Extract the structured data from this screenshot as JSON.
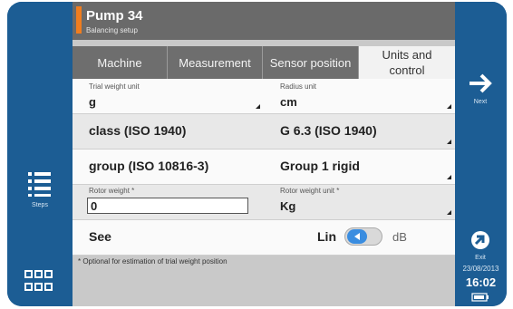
{
  "header": {
    "title": "Pump 34",
    "subtitle": "Balancing setup"
  },
  "tabs": [
    {
      "label": "Machine"
    },
    {
      "label": "Measurement"
    },
    {
      "label": "Sensor position"
    },
    {
      "label_line1": "Units and",
      "label_line2": "control"
    }
  ],
  "rows": {
    "trial_weight_unit": {
      "label": "Trial weight unit",
      "value": "g"
    },
    "radius_unit": {
      "label": "Radius unit",
      "value": "cm"
    },
    "class": {
      "value": "class (ISO 1940)"
    },
    "g_class": {
      "value": "G 6.3 (ISO 1940)"
    },
    "group": {
      "value": "group (ISO 10816-3)"
    },
    "group_value": {
      "value": "Group 1 rigid"
    },
    "rotor_weight": {
      "label": "Rotor weight *",
      "value": "0"
    },
    "rotor_weight_unit": {
      "label": "Rotor weight unit *",
      "value": "Kg"
    },
    "see": {
      "label": "See",
      "left": "Lin",
      "right": "dB"
    }
  },
  "note": "* Optional for estimation of trial weight position",
  "left_rail": {
    "steps_label": "Steps"
  },
  "right_rail": {
    "next_label": "Next",
    "exit_label": "Exit",
    "date": "23/08/2013",
    "time": "16:02"
  },
  "colors": {
    "rail": "#1c5d94",
    "header": "#6a6a6a",
    "accent": "#f07d1f",
    "toggle": "#3a8de0"
  },
  "icons": [
    "steps-list-icon",
    "grid-icon",
    "next-arrow-icon",
    "exit-icon",
    "battery-icon"
  ]
}
